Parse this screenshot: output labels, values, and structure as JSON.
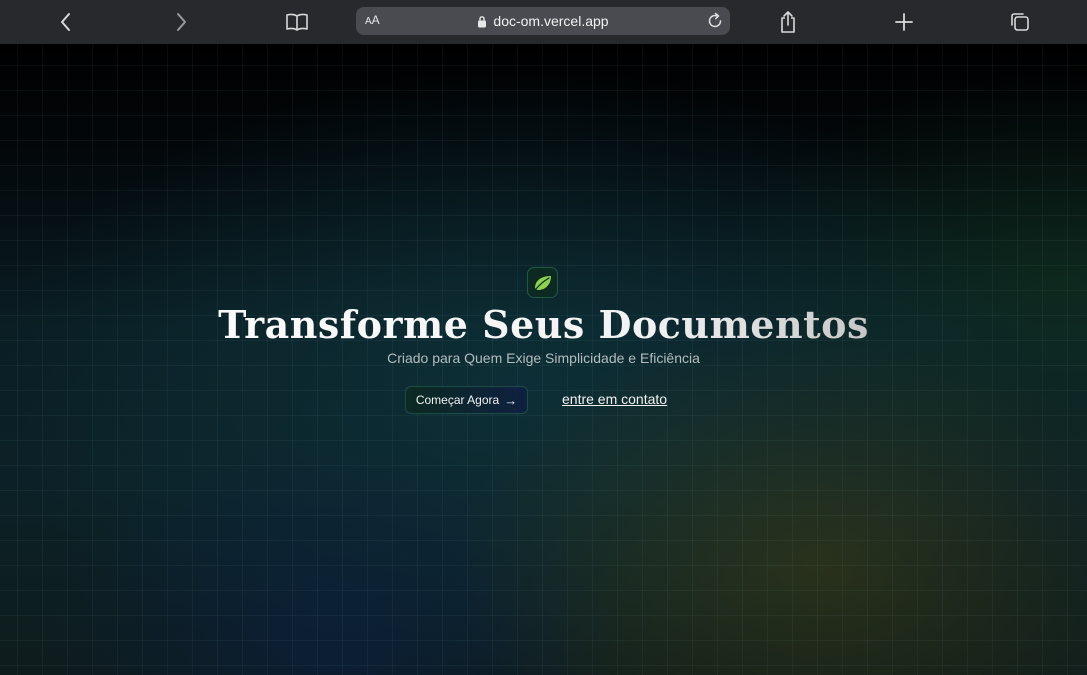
{
  "browser": {
    "url": "doc-om.vercel.app",
    "text_size_label": "AA",
    "icons": {
      "back": "chevron-left-icon",
      "forward": "chevron-right-icon",
      "bookmarks": "book-icon",
      "lock": "lock-icon",
      "reload": "reload-icon",
      "share": "share-icon",
      "new_tab": "plus-icon",
      "tabs": "tabs-icon"
    }
  },
  "hero": {
    "logo_icon": "leaf-icon",
    "title": "Transforme Seus Documentos",
    "subtitle": "Criado para Quem Exige Simplicidade e Eficiência",
    "primary_button": "Começar Agora",
    "primary_button_arrow": "→",
    "secondary_link": "entre em contato"
  },
  "colors": {
    "toolbar": "#27292d",
    "address_bar": "#4a4b50",
    "accent_green": "#7ed14a",
    "background": "#000000"
  }
}
